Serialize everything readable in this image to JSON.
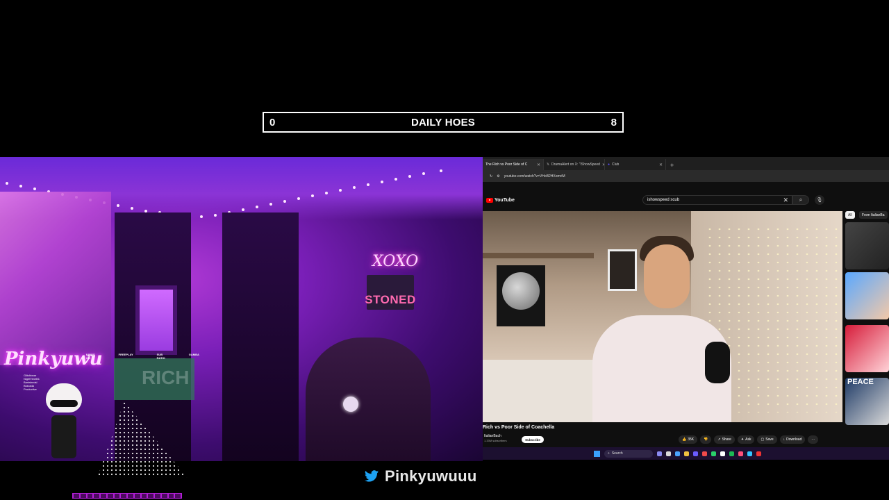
{
  "counter": {
    "left_value": "0",
    "title": "DAILY HOES",
    "right_value": "8"
  },
  "webcam": {
    "neon_xoxo": "XOXO",
    "neon_stoned": "STONED",
    "logo_text": "Pinkyuwu",
    "stats_headers": [
      "KINGS ON",
      "FREEPLAY",
      "SUB RATIO",
      "GAMBA"
    ],
    "stats_rows": [
      "Glitchbear",
      "NightTimeB1",
      "Banishedsl",
      "Bravada",
      "Productive"
    ],
    "board_text": "RICH"
  },
  "browser": {
    "tabs": [
      {
        "label": "The Rich vs Poor Side of C",
        "active": true
      },
      {
        "label": "DramaAlert on X: \"IShowSpeed",
        "active": false
      },
      {
        "label": "Club",
        "active": false
      }
    ],
    "new_tab": "+",
    "url": "youtube.com/watch?v=VHoB2HXomriM"
  },
  "youtube": {
    "logo": "YouTube",
    "search_value": "ishowspeed scub",
    "video_title": "Rich vs Poor Side of Coachella",
    "channel_name": "ItalianBach",
    "subscribers": "1.33M subscribers",
    "subscribe_label": "Subscribe",
    "actions": [
      "35K",
      "Share",
      "Ask",
      "Save",
      "Download"
    ],
    "chips": [
      "All",
      "From ItalianBa"
    ],
    "sidebar_peace": "PEACE",
    "brand_color": "#ff0000"
  },
  "taskbar": {
    "search_label": "Search"
  },
  "social": {
    "twitter_handle": "Pinkyuwuuu",
    "twitter_color": "#1da1f2"
  }
}
